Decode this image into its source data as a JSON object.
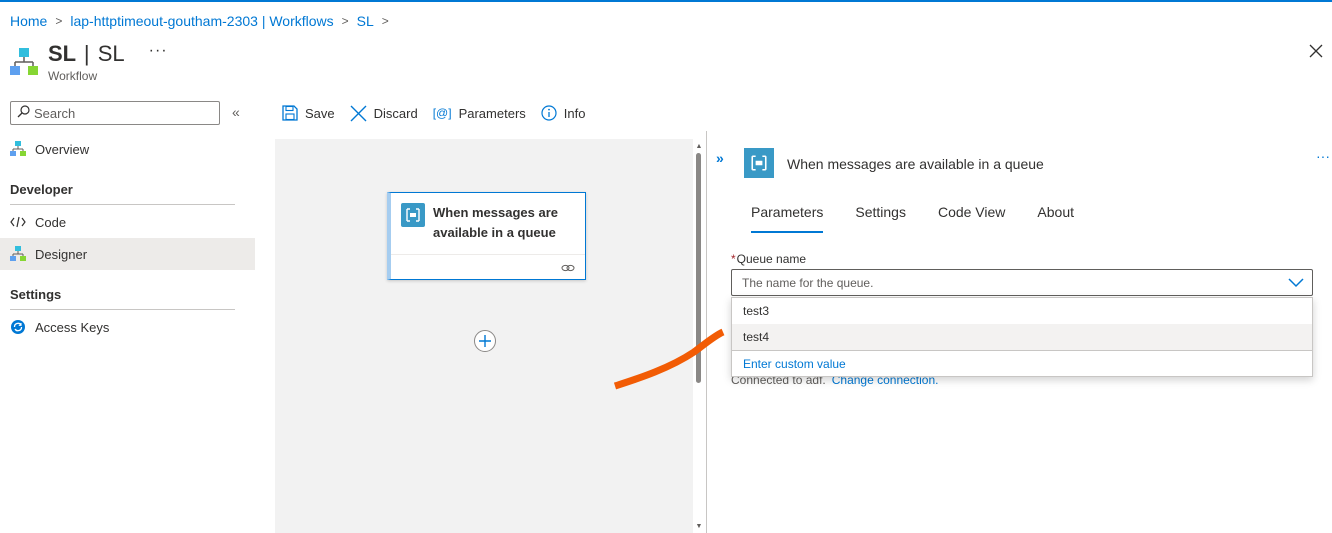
{
  "breadcrumb": {
    "home": "Home",
    "workflows": "lap-httptimeout-goutham-2303 | Workflows",
    "current": "SL"
  },
  "header": {
    "title_part1": "SL",
    "separator": "|",
    "title_part2": "SL",
    "subtitle": "Workflow",
    "more": "···"
  },
  "sidebar": {
    "search_placeholder": "Search",
    "collapse": "«",
    "overview": "Overview",
    "developer_header": "Developer",
    "code": "Code",
    "designer": "Designer",
    "settings_header": "Settings",
    "access_keys": "Access Keys"
  },
  "toolbar": {
    "save": "Save",
    "discard": "Discard",
    "parameters": "Parameters",
    "parameters_icon_text": "[@]",
    "info": "Info"
  },
  "canvas": {
    "card_title": "When messages are available in a queue"
  },
  "panel": {
    "expand": "»",
    "title": "When messages are available in a queue",
    "more": "···",
    "tabs": [
      "Parameters",
      "Settings",
      "Code View",
      "About"
    ],
    "active_tab": "Parameters",
    "queue_label": "Queue name",
    "required_mark": "*",
    "queue_placeholder": "The name for the queue.",
    "options": [
      "test3",
      "test4"
    ],
    "hovered_option": "test4",
    "custom_value": "Enter custom value",
    "connected_text": "Connected to adf.",
    "change_connection": "Change connection."
  },
  "colors": {
    "accent": "#0078d4",
    "icon_blue": "#3999c6",
    "annotation": "#f25c05"
  }
}
